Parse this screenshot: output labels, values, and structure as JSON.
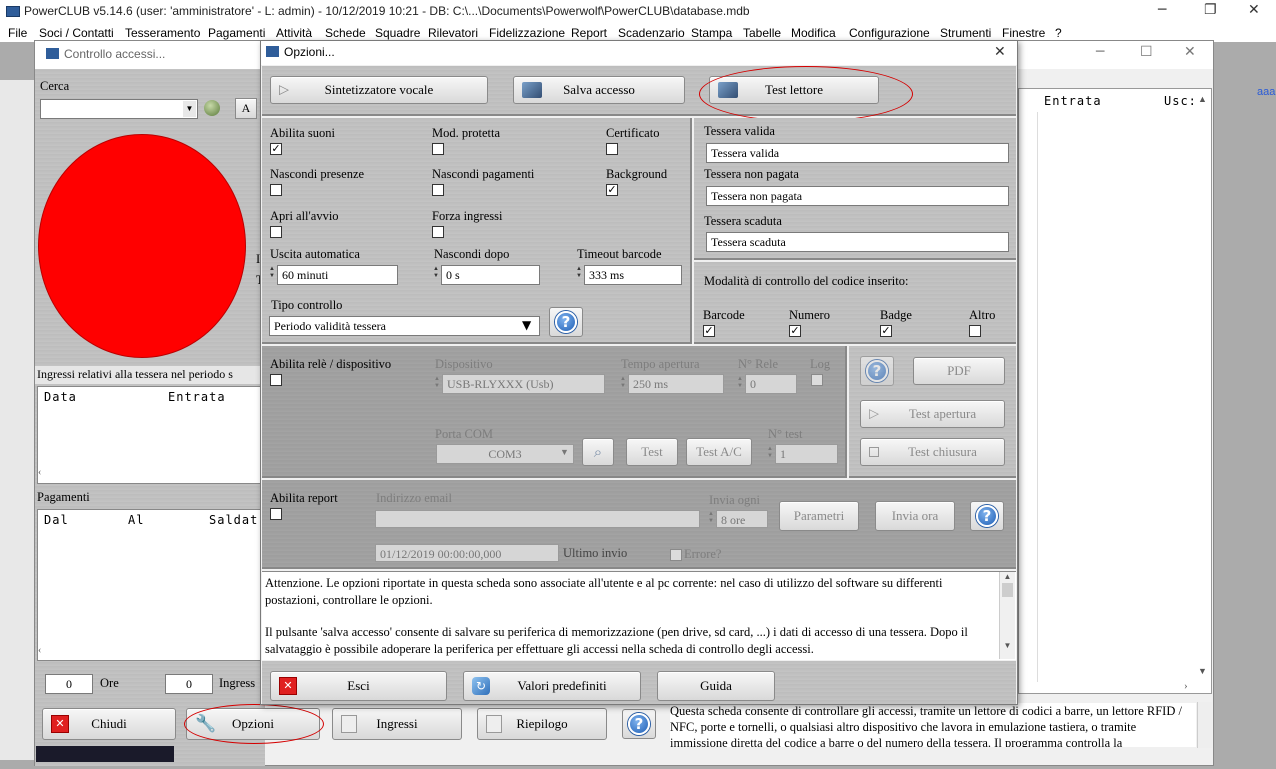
{
  "app": {
    "title": "PowerCLUB v5.14.6  (user: 'amministratore'  - L: admin) - 10/12/2019 10:21 - DB: C:\\...\\Documents\\Powerwolf\\PowerCLUB\\database.mdb",
    "menu": [
      "File",
      "Soci / Contatti",
      "Tesseramento",
      "Pagamenti",
      "Attività",
      "Schede",
      "Squadre",
      "Rilevatori",
      "Fidelizzazione",
      "Report",
      "Scadenzario",
      "Stampa",
      "Tabelle",
      "Modifica",
      "Configurazione",
      "Strumenti",
      "Finestre",
      "?"
    ],
    "side_link": "aaa",
    "bottom_info": "Questa scheda consente di controllare gli accessi, tramite un lettore di codici a barre, un lettore RFID / NFC, porte e tornelli, o qualsiasi altro dispositivo che lavora in emulazione tastiera, o tramite immissione diretta del codice a barre o del numero della tessera. Il programma controlla la"
  },
  "back_window": {
    "title": "Controllo accessi...",
    "search_label": "Cerca",
    "search_value": "",
    "a_button": "A",
    "grid_right_headers": [
      "Entrata",
      "Usc:"
    ],
    "ingressi_label": "Ingressi relativi alla tessera nel periodo s",
    "ingressi_headers": [
      "Data",
      "Entrata"
    ],
    "pagamenti_label": "Pagamenti",
    "pagamenti_headers": [
      "Dal",
      "Al",
      "Saldat"
    ],
    "ore_value": "0",
    "ore_label": "Ore",
    "ingressi_count": "0",
    "ingressi_count_label": "Ingress",
    "buttons": {
      "chiudi": "Chiudi",
      "opzioni": "Opzioni",
      "ingressi": "Ingressi",
      "riepilogo": "Riepilogo"
    },
    "partial_labels": [
      "I",
      "T"
    ],
    "status_color": "#ff0000"
  },
  "dialog": {
    "title": "Opzioni...",
    "top_buttons": {
      "sintetizzatore": "Sintetizzatore vocale",
      "salva": "Salva accesso",
      "test": "Test lettore"
    },
    "checks": {
      "abilita_suoni": {
        "label": "Abilita suoni",
        "checked": true
      },
      "mod_protetta": {
        "label": "Mod. protetta",
        "checked": false
      },
      "certificato": {
        "label": "Certificato",
        "checked": false
      },
      "nascondi_presenze": {
        "label": "Nascondi presenze",
        "checked": false
      },
      "nascondi_pagamenti": {
        "label": "Nascondi pagamenti",
        "checked": false
      },
      "background": {
        "label": "Background",
        "checked": true
      },
      "apri_avvio": {
        "label": "Apri all'avvio",
        "checked": false
      },
      "forza_ingressi": {
        "label": "Forza ingressi",
        "checked": false
      }
    },
    "uscita_label": "Uscita automatica",
    "uscita_value": "60 minuti",
    "nascondi_dopo_label": "Nascondi dopo",
    "nascondi_dopo_value": "0 s",
    "timeout_label": "Timeout barcode",
    "timeout_value": "333 ms",
    "tipo_controllo_label": "Tipo controllo",
    "tipo_controllo_value": "Periodo validità tessera",
    "tessera_valida_label": "Tessera valida",
    "tessera_valida_value": "Tessera valida",
    "tessera_non_pagata_label": "Tessera non pagata",
    "tessera_non_pagata_value": "Tessera non pagata",
    "tessera_scaduta_label": "Tessera scaduta",
    "tessera_scaduta_value": "Tessera scaduta",
    "modalita_label": "Modalità di controllo del codice inserito:",
    "modalita": [
      {
        "label": "Barcode",
        "checked": true
      },
      {
        "label": "Numero",
        "checked": true
      },
      {
        "label": "Badge",
        "checked": true
      },
      {
        "label": "Altro",
        "checked": false
      }
    ],
    "rele": {
      "abilita_label": "Abilita relè / dispositivo",
      "dispositivo_label": "Dispositivo",
      "dispositivo_value": "USB-RLYXXX (Usb)",
      "tempo_label": "Tempo apertura",
      "tempo_value": "250 ms",
      "nrele_label": "N° Rele",
      "nrele_value": "0",
      "log_label": "Log",
      "porta_label": "Porta COM",
      "porta_value": "COM3",
      "test_label": "Test",
      "test_ac_label": "Test A/C",
      "ntest_label": "N° test",
      "ntest_value": "1",
      "pdf_label": "PDF",
      "test_apertura": "Test apertura",
      "test_chiusura": "Test chiusura"
    },
    "report": {
      "abilita_label": "Abilita report",
      "email_label": "Indirizzo email",
      "email_value": "",
      "invia_ogni_label": "Invia ogni",
      "invia_ogni_value": "8 ore",
      "parametri": "Parametri",
      "invia_ora": "Invia ora",
      "ultimo_invio_value": "01/12/2019 00:00:00,000",
      "ultimo_invio_label": "Ultimo invio",
      "errore_label": "Errore?"
    },
    "info_text_1": "Attenzione. Le opzioni riportate in questa scheda sono associate all'utente e al pc corrente: nel caso di utilizzo del software su differenti postazioni, controllare le opzioni.",
    "info_text_2": "Il pulsante 'salva accesso' consente di salvare su periferica di memorizzazione (pen drive, sd card, ...) i dati di accesso di una tessera. Dopo il salvataggio è possibile adoperare la periferica per effettuare gli accessi nella scheda di controllo degli accessi.",
    "bottom_buttons": {
      "esci": "Esci",
      "valori": "Valori predefiniti",
      "guida": "Guida"
    }
  },
  "colors": {
    "highlight": "#d40000",
    "danger": "#e02020"
  }
}
